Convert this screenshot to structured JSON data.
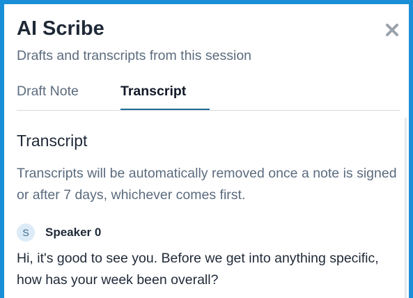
{
  "header": {
    "title": "AI Scribe",
    "subtitle": "Drafts and transcripts from this session",
    "close_icon": "close-icon"
  },
  "tabs": [
    {
      "label": "Draft Note",
      "active": false
    },
    {
      "label": "Transcript",
      "active": true
    }
  ],
  "transcript": {
    "section_title": "Transcript",
    "notice": "Transcripts will be automatically removed once a note is signed or after 7 days, whichever comes first.",
    "entries": [
      {
        "avatar_initial": "S",
        "speaker": "Speaker 0",
        "text": "Hi, it's good to see you. Before we get into anything specific, how has your week been overall?"
      }
    ]
  },
  "colors": {
    "window_border": "#1a8fd8",
    "active_tab_underline": "#1f6d94",
    "muted_text": "#5b6b7e",
    "avatar_bg": "#dcebf7"
  }
}
